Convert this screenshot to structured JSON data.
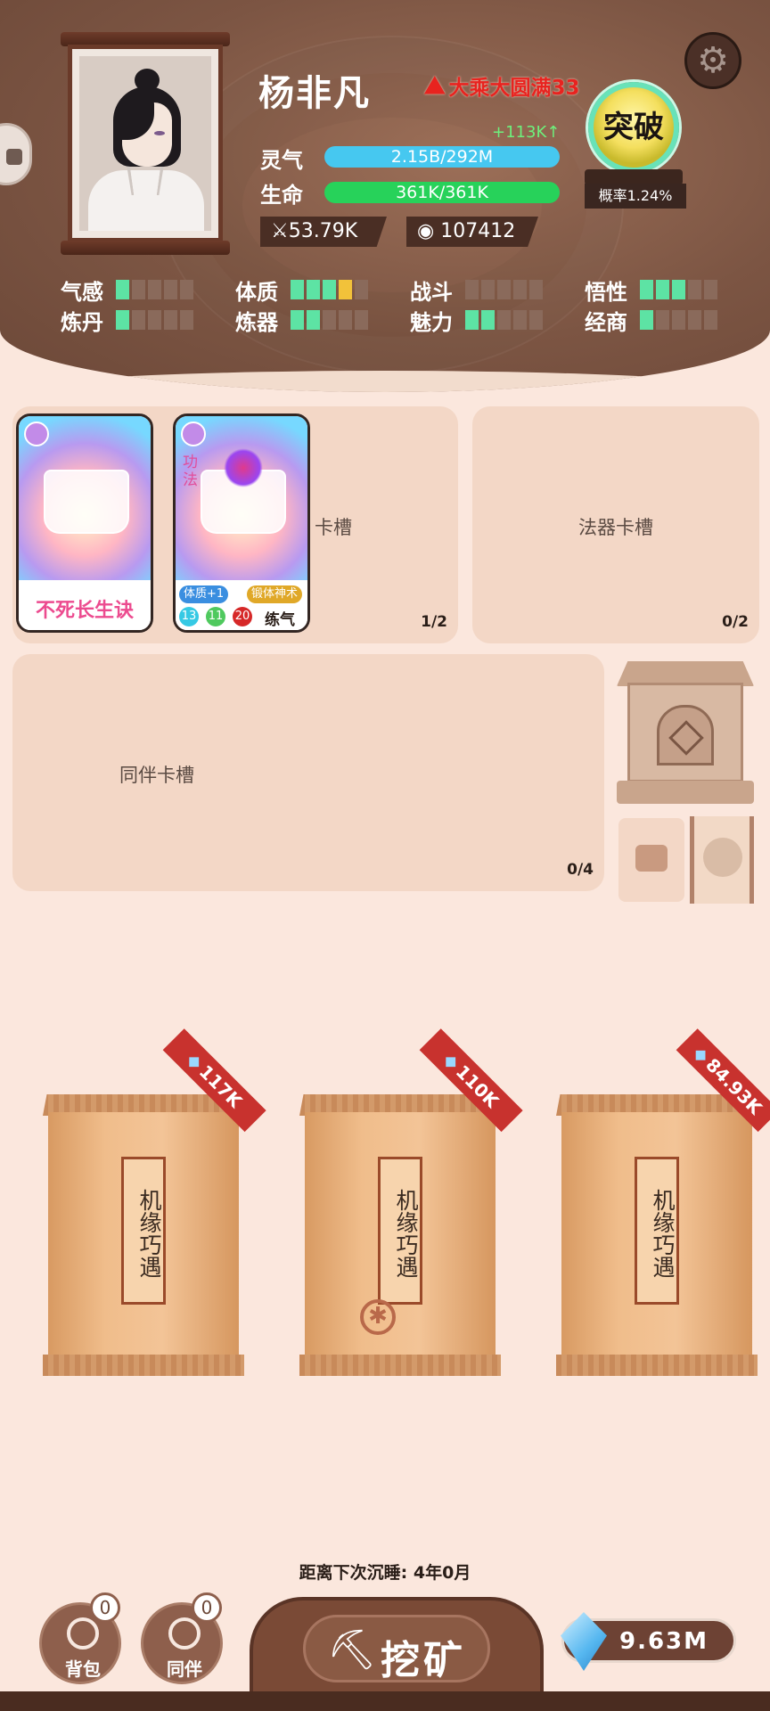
{
  "player": {
    "name": "杨非凡",
    "realm": "大乘大圆满33",
    "qi_label": "灵气",
    "qi_value": "2.15B/292M",
    "qi_gain": "+113K↑",
    "hp_label": "生命",
    "hp_value": "361K/361K",
    "hp_fill": 1.0,
    "power": "53.79K",
    "coins": "107412"
  },
  "breakthrough": {
    "label": "突破",
    "rate": "概率1.24%"
  },
  "attributes": [
    {
      "name": "气感",
      "on": 1,
      "gold": 0
    },
    {
      "name": "体质",
      "on": 3,
      "gold": 1
    },
    {
      "name": "战斗",
      "on": 0,
      "gold": 0
    },
    {
      "name": "悟性",
      "on": 3,
      "gold": 0
    },
    {
      "name": "炼丹",
      "on": 1,
      "gold": 0
    },
    {
      "name": "炼器",
      "on": 2,
      "gold": 0
    },
    {
      "name": "魅力",
      "on": 2,
      "gold": 0
    },
    {
      "name": "经商",
      "on": 1,
      "gold": 0
    }
  ],
  "slots": {
    "technique": {
      "label": "卡槽",
      "count": "1/2"
    },
    "artifact": {
      "label": "法器卡槽",
      "count": "0/2"
    },
    "companion": {
      "label": "同伴卡槽",
      "count": "0/4"
    }
  },
  "cards": {
    "card1": {
      "name": "不死长生诀"
    },
    "card2": {
      "type": "功法",
      "chip_attr": "体质+1",
      "chip_skill": "锻体神术",
      "n1": "13",
      "n2": "11",
      "n3": "20",
      "realm": "练气"
    }
  },
  "packs": [
    {
      "title": "机缘巧遇",
      "price": "117K"
    },
    {
      "title": "机缘巧遇",
      "price": "110K"
    },
    {
      "title": "机缘巧遇",
      "price": "84.93K"
    }
  ],
  "sleep_text": "距离下次沉睡: 4年0月",
  "nav": {
    "bag_label": "背包",
    "bag_badge": "0",
    "companion_label": "同伴",
    "companion_badge": "0",
    "mine_label": "挖矿"
  },
  "currency": {
    "gems": "9.63M"
  },
  "colors": {
    "header": "#7c5543",
    "background": "#fbe7dd",
    "qi_bar": "#46c8f0",
    "hp_bar": "#27d25a",
    "pip_on": "#5de3a4",
    "realm_red": "#e8231f"
  }
}
